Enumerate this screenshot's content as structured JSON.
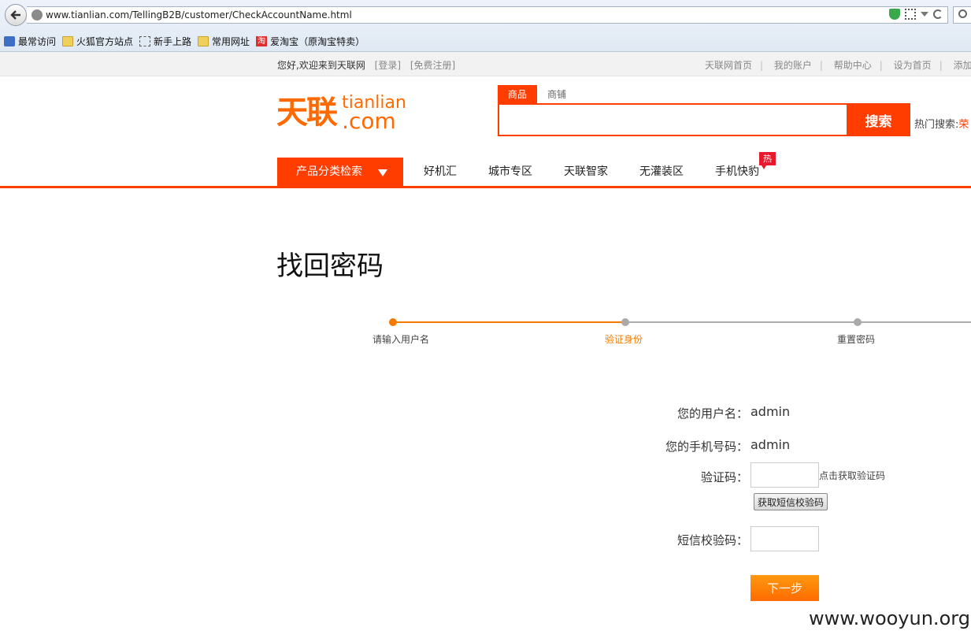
{
  "browser": {
    "url": "www.tianlian.com/TellingB2B/customer/CheckAccountName.html",
    "bookmarks": [
      "最常访问",
      "火狐官方站点",
      "新手上路",
      "常用网址",
      "爱淘宝（原淘宝特卖）"
    ],
    "taobao_icon_char": "淘"
  },
  "topbar": {
    "welcome": "您好,欢迎来到天联网",
    "login": "[登录]",
    "register": "[免费注册]",
    "links": [
      "天联网首页",
      "我的账户",
      "帮助中心",
      "设为首页",
      "添加收藏"
    ]
  },
  "header": {
    "logo_cn": "天联",
    "logo_en_top": "tianlian",
    "logo_en_bottom": ".com",
    "search_tabs": [
      "商品",
      "商铺"
    ],
    "search_button": "搜索",
    "hot_search_label": "热门搜索:",
    "hot_search_word": "荣"
  },
  "nav": {
    "category": "产品分类检索",
    "items": [
      "好机汇",
      "城市专区",
      "天联智家",
      "无灌装区",
      "手机快豹"
    ],
    "hot_badge": "热"
  },
  "main": {
    "title": "找回密码",
    "steps": [
      "请输入用户名",
      "验证身份",
      "重置密码"
    ],
    "current_step": 2,
    "username_label": "您的用户名：",
    "username_value": "admin",
    "phone_label": "您的手机号码：",
    "phone_value": "admin",
    "captcha_label": "验证码：",
    "captcha_hint": "点击获取验证码",
    "sms_button": "获取短信校验码",
    "sms_code_label": "短信校验码：",
    "next_button": "下一步"
  },
  "colors": {
    "brand_orange": "#ff6a00",
    "brand_red": "#ff3d00",
    "step_active": "#f57b00",
    "step_inactive": "#aaaaaa"
  },
  "watermark": "www.wooyun.org"
}
